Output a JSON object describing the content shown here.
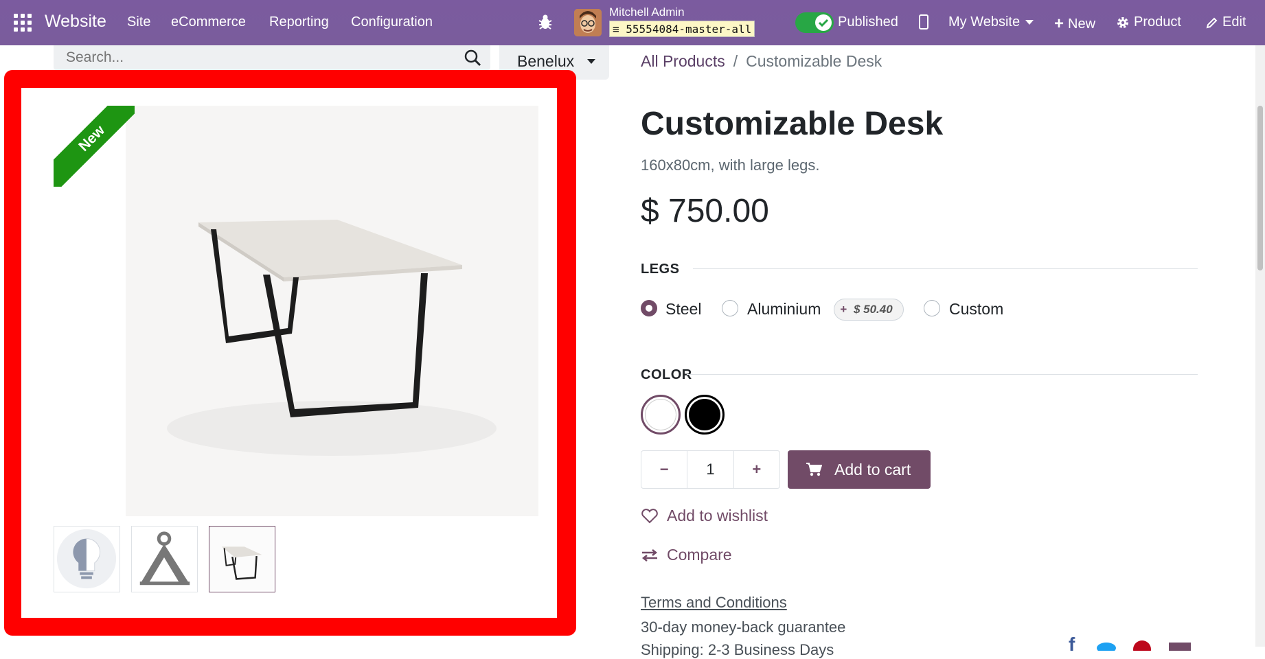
{
  "topbar": {
    "brand": "Website",
    "menus": [
      "Site",
      "eCommerce",
      "Reporting",
      "Configuration"
    ],
    "user_name": "Mitchell Admin",
    "database": "55554084-master-all",
    "published_label": "Published",
    "website_label": "My Website",
    "new_label": "New",
    "product_label": "Product",
    "edit_label": "Edit"
  },
  "search": {
    "placeholder": "Search...",
    "pricelist": "Benelux"
  },
  "breadcrumb": {
    "parent": "All Products",
    "separator": "/",
    "current": "Customizable Desk"
  },
  "product": {
    "ribbon": "New",
    "name": "Customizable Desk",
    "description": "160x80cm, with large legs.",
    "price": "$ 750.00"
  },
  "attributes": {
    "legs_label": "LEGS",
    "legs_options": [
      "Steel",
      "Aluminium",
      "Custom"
    ],
    "legs_selected": "Steel",
    "aluminium_extra_sign": "+",
    "aluminium_extra": "$ 50.40",
    "color_label": "COLOR",
    "colors": [
      "#ffffff",
      "#000000"
    ],
    "color_selected": "#ffffff"
  },
  "cart": {
    "quantity": "1",
    "add_label": "Add to cart"
  },
  "links": {
    "wishlist": "Add to wishlist",
    "compare": "Compare"
  },
  "terms": {
    "terms_label": "Terms and Conditions",
    "guarantee": "30-day money-back guarantee",
    "shipping": "Shipping: 2-3 Business Days"
  },
  "colors": {
    "brand": "#714b67",
    "topbar": "#7b5c9e",
    "ribbon": "#1e9512",
    "highlight": "#ff0000"
  }
}
